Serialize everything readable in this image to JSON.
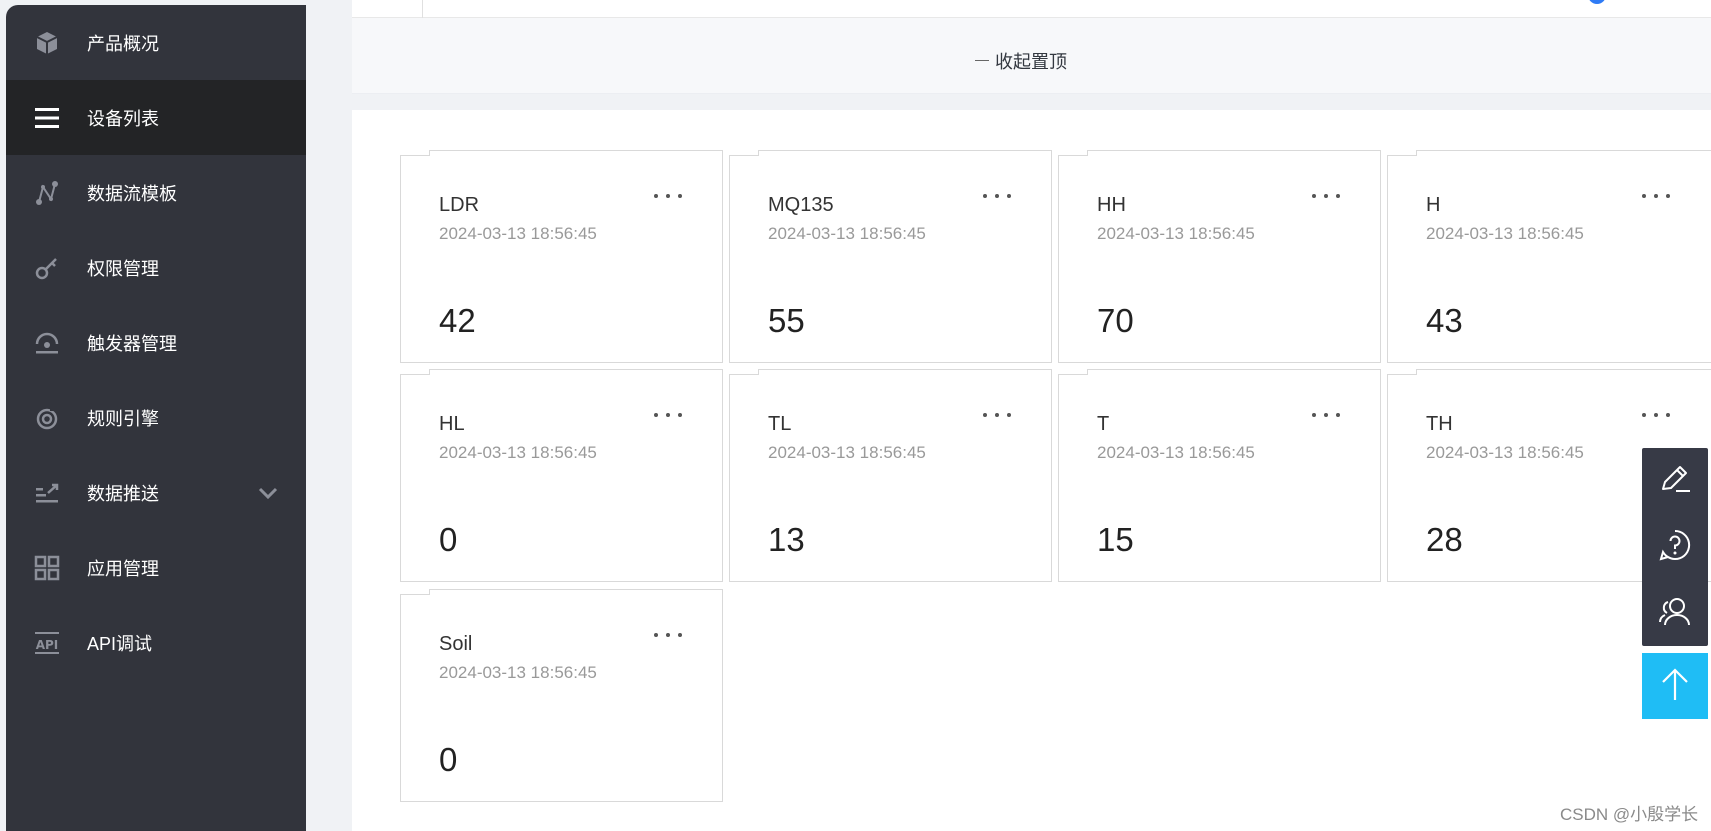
{
  "sidebar": {
    "items": [
      {
        "label": "产品概况",
        "icon": "cube-icon"
      },
      {
        "label": "设备列表",
        "icon": "list-icon",
        "active": true
      },
      {
        "label": "数据流模板",
        "icon": "data-flow-icon"
      },
      {
        "label": "权限管理",
        "icon": "key-icon"
      },
      {
        "label": "触发器管理",
        "icon": "trigger-icon"
      },
      {
        "label": "规则引擎",
        "icon": "rule-engine-icon"
      },
      {
        "label": "数据推送",
        "icon": "data-push-icon",
        "expandable": true
      },
      {
        "label": "应用管理",
        "icon": "grid-apps-icon"
      },
      {
        "label": "API调试",
        "icon": "api-icon"
      }
    ],
    "background": "#32343c",
    "active_background": "#232426"
  },
  "collapse_bar": {
    "label": "收起置顶"
  },
  "cards": [
    {
      "name": "LDR",
      "time": "2024-03-13 18:56:45",
      "value": "42"
    },
    {
      "name": "MQ135",
      "time": "2024-03-13 18:56:45",
      "value": "55"
    },
    {
      "name": "HH",
      "time": "2024-03-13 18:56:45",
      "value": "70"
    },
    {
      "name": "H",
      "time": "2024-03-13 18:56:45",
      "value": "43"
    },
    {
      "name": "HL",
      "time": "2024-03-13 18:56:45",
      "value": "0"
    },
    {
      "name": "TL",
      "time": "2024-03-13 18:56:45",
      "value": "13"
    },
    {
      "name": "T",
      "time": "2024-03-13 18:56:45",
      "value": "15"
    },
    {
      "name": "TH",
      "time": "2024-03-13 18:56:45",
      "value": "28"
    },
    {
      "name": "Soil",
      "time": "2024-03-13 18:56:45",
      "value": "0"
    }
  ],
  "float_toolbar": {
    "buttons": [
      "edit-icon",
      "help-icon",
      "users-icon"
    ],
    "top_button": "arrow-up-icon",
    "accent": "#1fbdf5"
  },
  "watermark": "CSDN @小殷学长"
}
